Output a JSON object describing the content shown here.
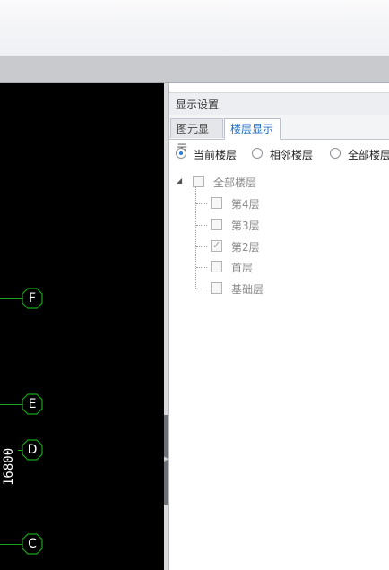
{
  "panel": {
    "title": "显示设置",
    "tabs": [
      {
        "label": "图元显示",
        "active": false
      },
      {
        "label": "楼层显示",
        "active": true
      }
    ],
    "radios": [
      {
        "label": "当前楼层",
        "selected": true
      },
      {
        "label": "相邻楼层",
        "selected": false
      },
      {
        "label": "全部楼层",
        "selected": false
      }
    ],
    "tree": {
      "root": {
        "label": "全部楼层",
        "checked": false,
        "expanded": true
      },
      "children": [
        {
          "label": "第4层",
          "checked": false
        },
        {
          "label": "第3层",
          "checked": false
        },
        {
          "label": "第2层",
          "checked": true
        },
        {
          "label": "首层",
          "checked": false
        },
        {
          "label": "基础层",
          "checked": false
        }
      ]
    }
  },
  "canvas": {
    "axes": [
      {
        "label": "F"
      },
      {
        "label": "E"
      },
      {
        "label": "D"
      },
      {
        "label": "C"
      }
    ],
    "dimension": "16800",
    "axis_color": "#1aa31a",
    "background": "#000000"
  },
  "colors": {
    "active_tab_text": "#1d6fc7",
    "radio_dot": "#2a7bd8"
  }
}
